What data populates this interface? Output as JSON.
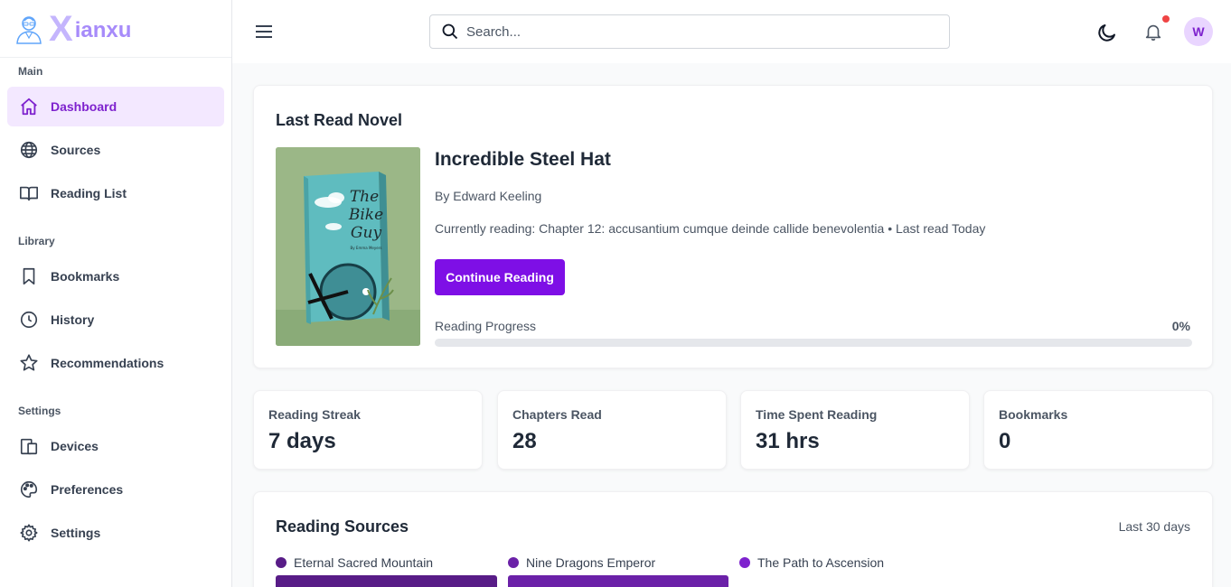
{
  "brand": {
    "letter": "X",
    "name": "ianxu"
  },
  "sidebar": {
    "sections": [
      {
        "label": "Main"
      },
      {
        "label": "Library"
      },
      {
        "label": "Settings"
      }
    ],
    "items": [
      {
        "label": "Dashboard",
        "icon": "home-icon",
        "active": true
      },
      {
        "label": "Sources",
        "icon": "globe-icon"
      },
      {
        "label": "Reading List",
        "icon": "book-open-icon"
      },
      {
        "label": "Bookmarks",
        "icon": "bookmark-icon"
      },
      {
        "label": "History",
        "icon": "clock-icon"
      },
      {
        "label": "Recommendations",
        "icon": "star-icon"
      },
      {
        "label": "Devices",
        "icon": "devices-icon"
      },
      {
        "label": "Preferences",
        "icon": "palette-icon"
      },
      {
        "label": "Settings",
        "icon": "gear-icon"
      }
    ]
  },
  "header": {
    "search_placeholder": "Search...",
    "user_initial": "W",
    "has_notification": true
  },
  "last_read": {
    "heading": "Last Read Novel",
    "cover": {
      "title_line1": "The",
      "title_line2": "Bike",
      "title_line3": "Guy",
      "byline": "By Emma Meyers"
    },
    "title": "Incredible Steel Hat",
    "author": "By Edward Keeling",
    "current": "Currently reading: Chapter 12: accusantium cumque deinde callide benevolentia • Last read Today",
    "button": "Continue Reading",
    "progress_label": "Reading Progress",
    "progress_text": "0%",
    "progress_value": 0
  },
  "stats": [
    {
      "label": "Reading Streak",
      "value": "7 days"
    },
    {
      "label": "Chapters Read",
      "value": "28"
    },
    {
      "label": "Time Spent Reading",
      "value": "31 hrs"
    },
    {
      "label": "Bookmarks",
      "value": "0"
    }
  ],
  "reading_sources": {
    "title": "Reading Sources",
    "period": "Last 30 days",
    "legend": [
      {
        "name": "Eternal Sacred Mountain",
        "color": "#581c87"
      },
      {
        "name": "Nine Dragons Emperor",
        "color": "#6b21a8"
      },
      {
        "name": "The Path to Ascension",
        "color": "#7e22ce"
      }
    ]
  },
  "colors": {
    "accent": "#7e0fe6",
    "active_bg": "#f3e8ff"
  }
}
